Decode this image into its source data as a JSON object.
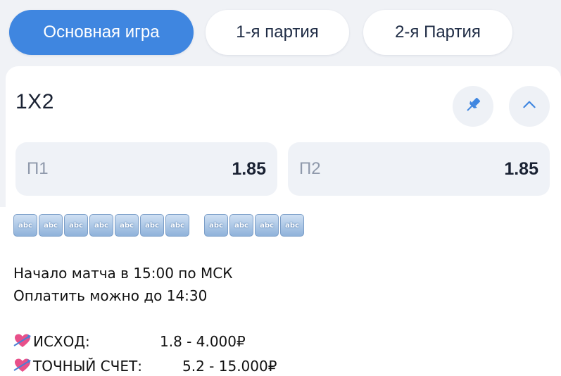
{
  "tabs": [
    {
      "label": "Основная игра",
      "active": true
    },
    {
      "label": "1-я партия",
      "active": false
    },
    {
      "label": "2-я Партия",
      "active": false
    }
  ],
  "market": {
    "title": "1X2",
    "pin_icon": "pin-icon",
    "collapse_icon": "chevron-up-icon",
    "odds": [
      {
        "label": "П1",
        "value": "1.85"
      },
      {
        "label": "П2",
        "value": "1.85"
      }
    ]
  },
  "abc_icons": {
    "text": "abc",
    "group1_count": 7,
    "group2_count": 4
  },
  "message": {
    "start": "Начало матча в 15:00 по МСК",
    "pay": "Оплатить можно до 14:30",
    "outcome_label": "ИСХОД:",
    "outcome_value": "1.8 - 4.000₽",
    "exact_label": "ТОЧНЫЙ СЧЕТ:",
    "exact_value": "5.2 - 15.000₽",
    "emoji_icon": "heart-arrow-icon"
  },
  "colors": {
    "accent": "#3f86e0",
    "background": "#f0f2f6",
    "pin": "#3f86e0"
  }
}
